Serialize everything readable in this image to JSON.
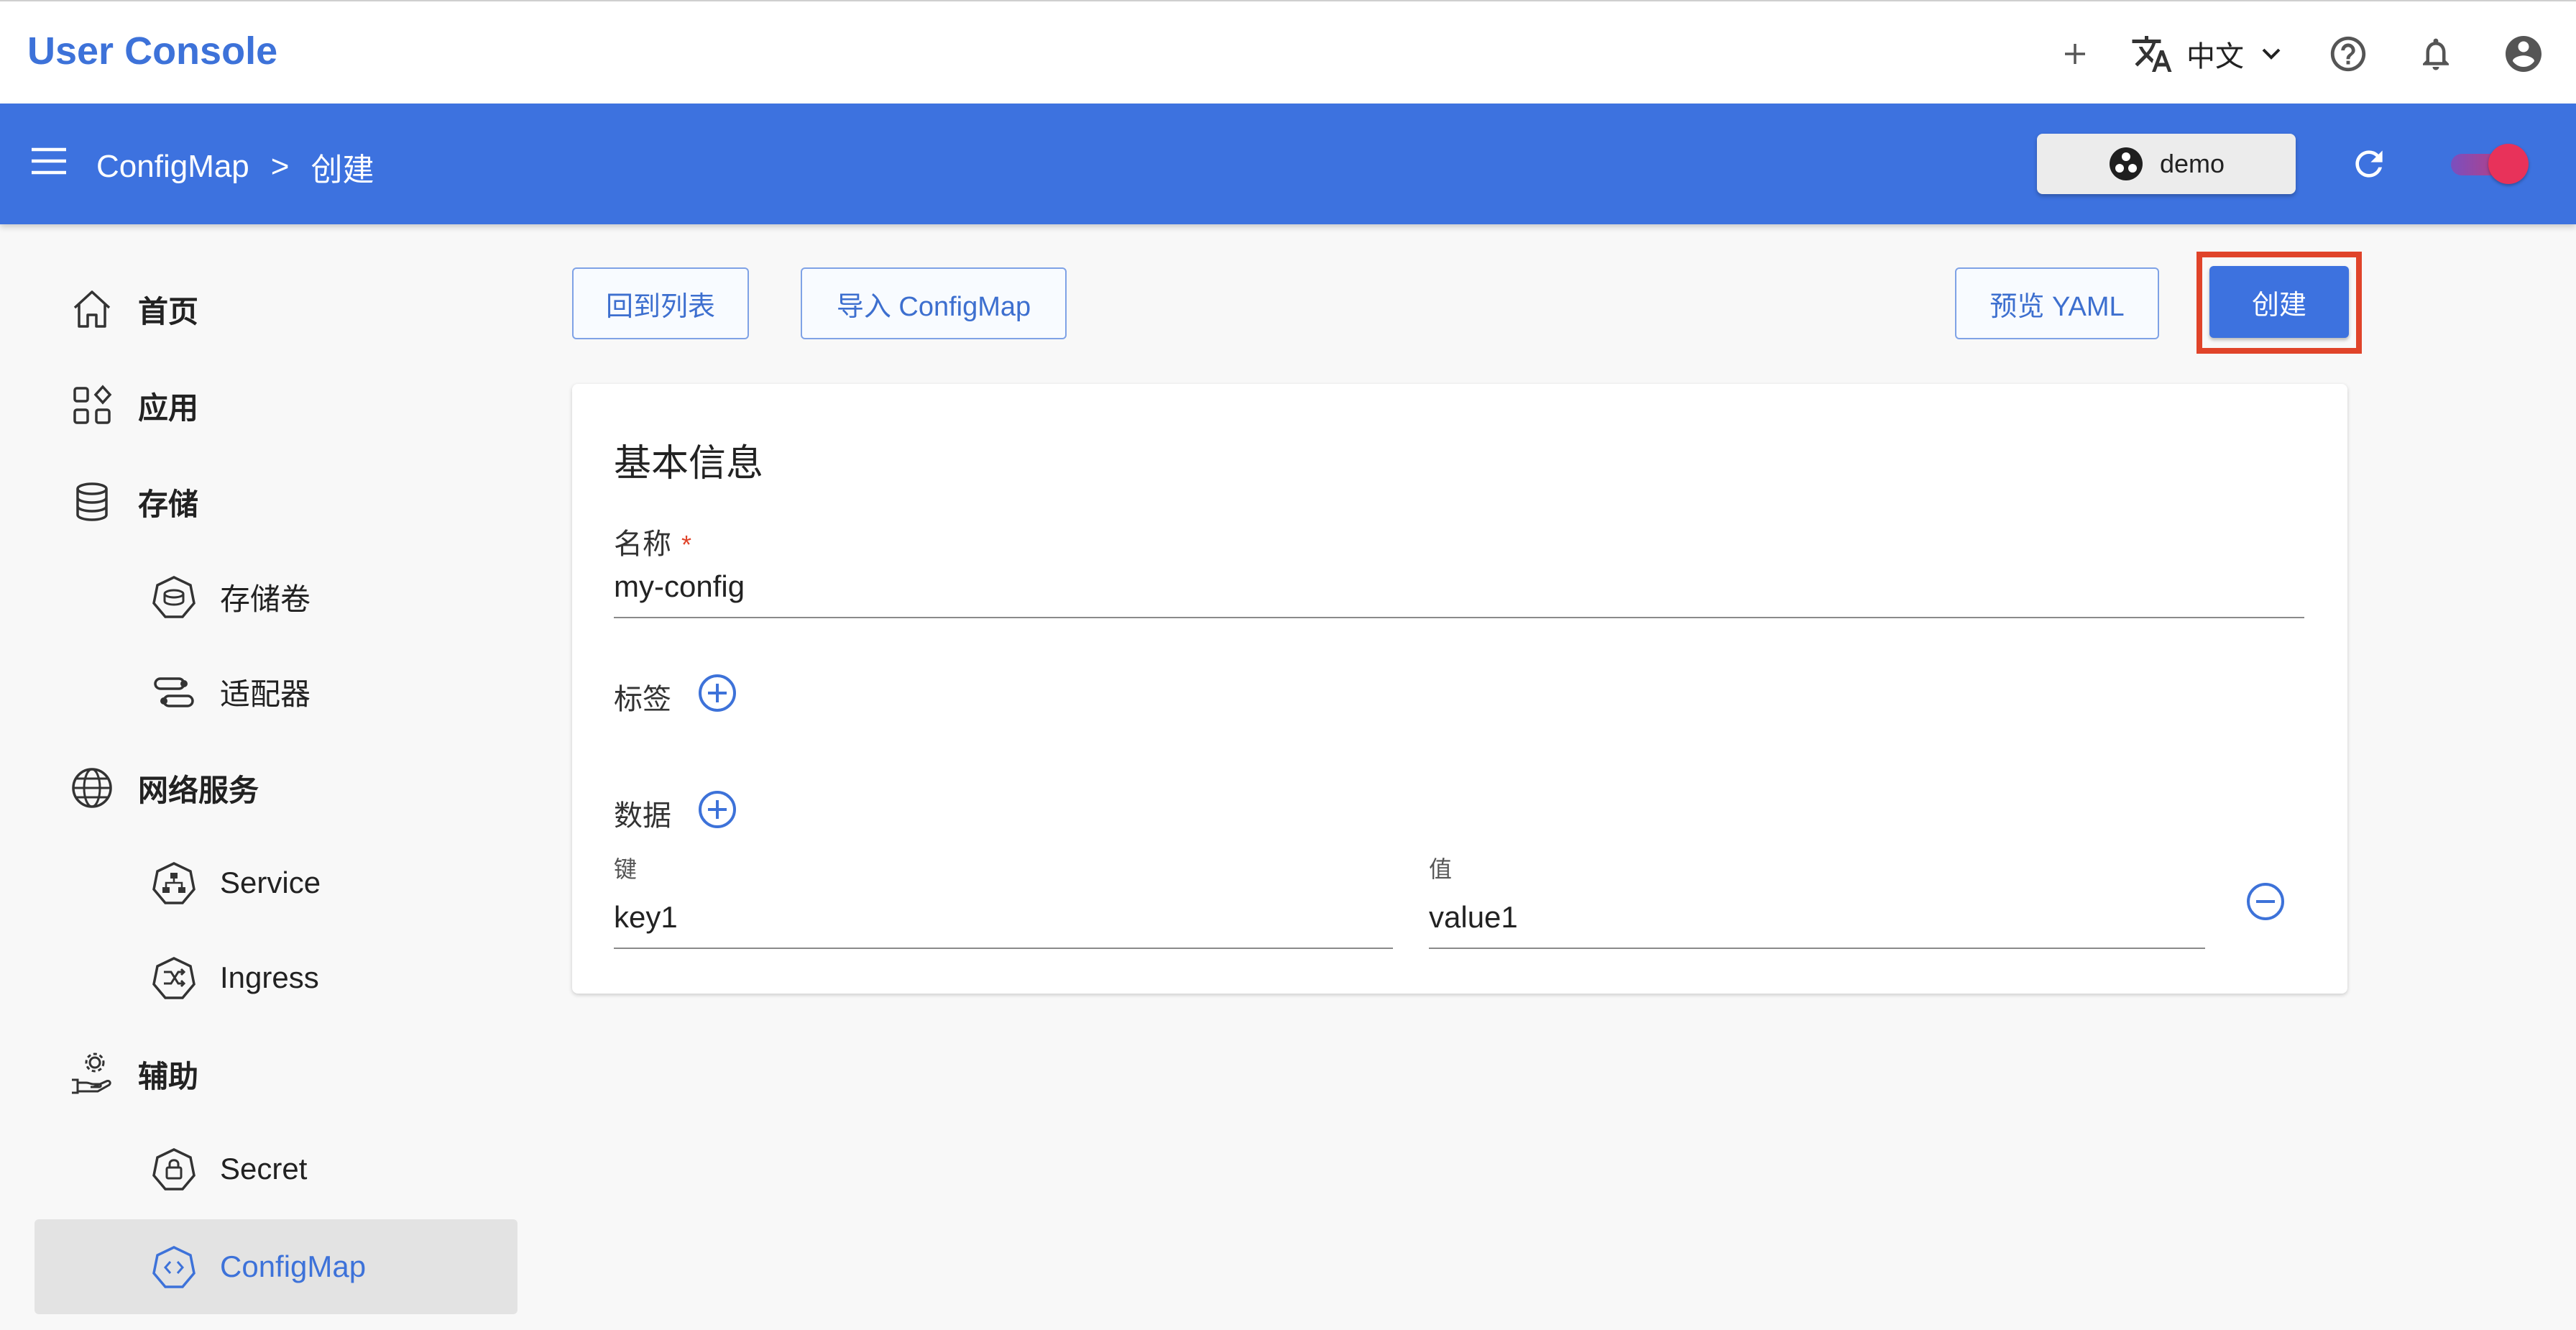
{
  "header": {
    "brand": "User Console",
    "language_label": "中文",
    "icons": [
      "plus-icon",
      "translate-icon",
      "chevron-down-icon",
      "help-icon",
      "bell-icon",
      "account-icon"
    ]
  },
  "subbar": {
    "breadcrumb": [
      "ConfigMap",
      "创建"
    ],
    "breadcrumb_separator": ">",
    "namespace_label": "demo",
    "toggle_on": true
  },
  "sidebar": {
    "items": [
      {
        "label": "首页",
        "icon": "home-icon",
        "level": 1
      },
      {
        "label": "应用",
        "icon": "apps-icon",
        "level": 1
      },
      {
        "label": "存储",
        "icon": "database-icon",
        "level": 1
      },
      {
        "label": "存储卷",
        "icon": "volume-icon",
        "level": 2
      },
      {
        "label": "适配器",
        "icon": "adapter-icon",
        "level": 2
      },
      {
        "label": "网络服务",
        "icon": "globe-icon",
        "level": 1
      },
      {
        "label": "Service",
        "icon": "service-icon",
        "level": 2
      },
      {
        "label": "Ingress",
        "icon": "ingress-icon",
        "level": 2
      },
      {
        "label": "辅助",
        "icon": "hand-gear-icon",
        "level": 1
      },
      {
        "label": "Secret",
        "icon": "secret-icon",
        "level": 2
      },
      {
        "label": "ConfigMap",
        "icon": "configmap-icon",
        "level": 2,
        "active": true
      }
    ]
  },
  "toolbar": {
    "back_label": "回到列表",
    "import_label": "导入 ConfigMap",
    "preview_label": "预览 YAML",
    "create_label": "创建"
  },
  "form": {
    "section_title": "基本信息",
    "name_label": "名称",
    "name_required_mark": "*",
    "name_value": "my-config",
    "labels_label": "标签",
    "data_label": "数据",
    "key_label": "键",
    "value_label": "值",
    "data_rows": [
      {
        "key": "key1",
        "value": "value1"
      }
    ]
  },
  "colors": {
    "primary": "#3d72df",
    "highlight": "#e0442a",
    "toggle": "#e8325a"
  }
}
